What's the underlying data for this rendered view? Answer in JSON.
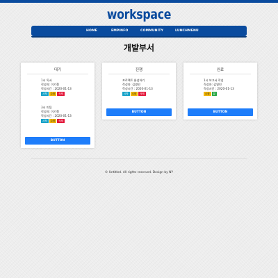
{
  "brand": {
    "logo_text": "workspace",
    "accent_color": "#0a4b9e",
    "button_color": "#1e7dfa"
  },
  "nav": {
    "items": [
      "HOME",
      "EMPINFO",
      "COMMUNITY",
      "LUNCHMENU"
    ]
  },
  "page": {
    "title": "개발부서"
  },
  "columns": [
    {
      "title": "대기",
      "items": [
        {
          "name": "1시 독서",
          "author": "작성자: 이기철",
          "time": "작성시간 : 2020-01-13",
          "badges": [
            "시작",
            "수정",
            "삭제"
          ]
        },
        {
          "name": "3시 미팅",
          "author": "작성자: 이기철",
          "time": "작성시간 : 2020-01-13",
          "badges": [
            "시작",
            "수정",
            "삭제"
          ]
        }
      ],
      "button_label": "BUTTON"
    },
    {
      "title": "진행",
      "items": [
        {
          "name": "프로젝트 완성하기",
          "author": "작성자: 김영민",
          "time": "작성시간 : 2020-01-13",
          "badges": [
            "시작",
            "수정",
            "삭제"
          ]
        }
      ],
      "button_label": "BUTTON"
    },
    {
      "title": "완료",
      "items": [
        {
          "name": "1시 보고서 작성",
          "author": "작성자: 김영민",
          "time": "작성시간 : 2020-01-13",
          "badges": [
            "수정",
            "끝"
          ]
        }
      ],
      "button_label": "BUTTON"
    }
  ],
  "footer": {
    "text": "© Untitled. All rights reserved. Design by NY"
  }
}
